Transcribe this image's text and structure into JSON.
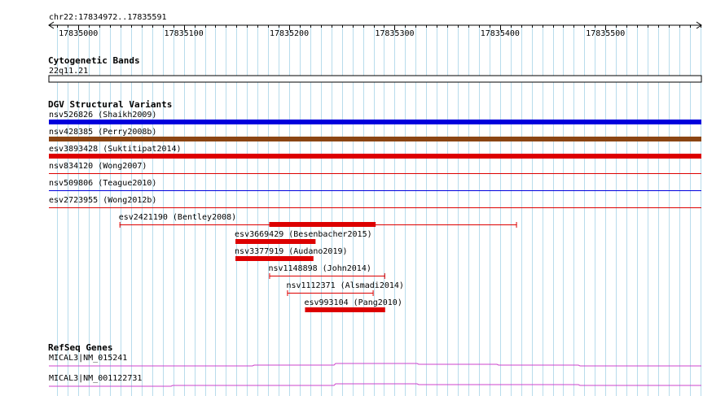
{
  "region": {
    "label": "chr22:17834972..17835591",
    "start": 17834972,
    "end": 17835591,
    "ticks": [
      17835000,
      17835100,
      17835200,
      17835300,
      17835400,
      17835500
    ],
    "tick_labels": [
      "17835000",
      "17835100",
      "17835200",
      "17835300",
      "17835400",
      "17835500"
    ]
  },
  "cytoband_track": {
    "title": "Cytogenetic Bands",
    "bands": [
      {
        "name": "22q11.21"
      }
    ]
  },
  "dgv_track": {
    "title": "DGV Structural Variants",
    "colors": {
      "gain": "#0000dd",
      "loss": "#dd0000",
      "gain_loss": "#8b4513"
    },
    "variants": [
      {
        "id": "nsv526826",
        "label": "nsv526826 (Shaikh2009)",
        "start": 17834972,
        "end": 17835591,
        "type": "gain",
        "thick": true
      },
      {
        "id": "nsv428385",
        "label": "nsv428385 (Perry2008b)",
        "start": 17834972,
        "end": 17835591,
        "type": "gain_loss",
        "thick": true
      },
      {
        "id": "esv3893428",
        "label": "esv3893428 (Suktitipat2014)",
        "start": 17834972,
        "end": 17835591,
        "type": "loss",
        "thick": true
      },
      {
        "id": "nsv834120",
        "label": "nsv834120 (Wong2007)",
        "start": 17834972,
        "end": 17835591,
        "type": "loss",
        "thick": false
      },
      {
        "id": "nsv509806",
        "label": "nsv509806 (Teague2010)",
        "start": 17834972,
        "end": 17835591,
        "type": "gain",
        "thick": false
      },
      {
        "id": "esv2723955",
        "label": "esv2723955 (Wong2012b)",
        "start": 17834972,
        "end": 17835591,
        "type": "loss",
        "thick": false
      },
      {
        "id": "esv2421190",
        "label": "esv2421190 (Bentley2008)",
        "start": 17835039,
        "end": 17835416,
        "type": "loss",
        "thick": false,
        "thick_start": 17835181,
        "thick_end": 17835282
      },
      {
        "id": "esv3669429",
        "label": "esv3669429 (Besenbacher2015)",
        "start": 17835149,
        "end": 17835225,
        "type": "loss",
        "thick": true
      },
      {
        "id": "nsv3377919",
        "label": "nsv3377919 (Audano2019)",
        "start": 17835149,
        "end": 17835223,
        "type": "loss",
        "thick": true
      },
      {
        "id": "nsv1148898",
        "label": "nsv1148898 (John2014)",
        "start": 17835181,
        "end": 17835291,
        "type": "loss",
        "thick": false
      },
      {
        "id": "nsv1112371",
        "label": "nsv1112371 (Alsmadi2014)",
        "start": 17835198,
        "end": 17835280,
        "type": "loss",
        "thick": false
      },
      {
        "id": "esv993104",
        "label": "esv993104 (Pang2010)",
        "start": 17835215,
        "end": 17835291,
        "type": "loss",
        "thick": true
      }
    ]
  },
  "refseq_track": {
    "title": "RefSeq Genes",
    "color": "#cc44cc",
    "genes": [
      {
        "id": "NM_015241",
        "label": "MICAL3|NM_015241"
      },
      {
        "id": "NM_001122731",
        "label": "MICAL3|NM_001122731"
      }
    ]
  }
}
